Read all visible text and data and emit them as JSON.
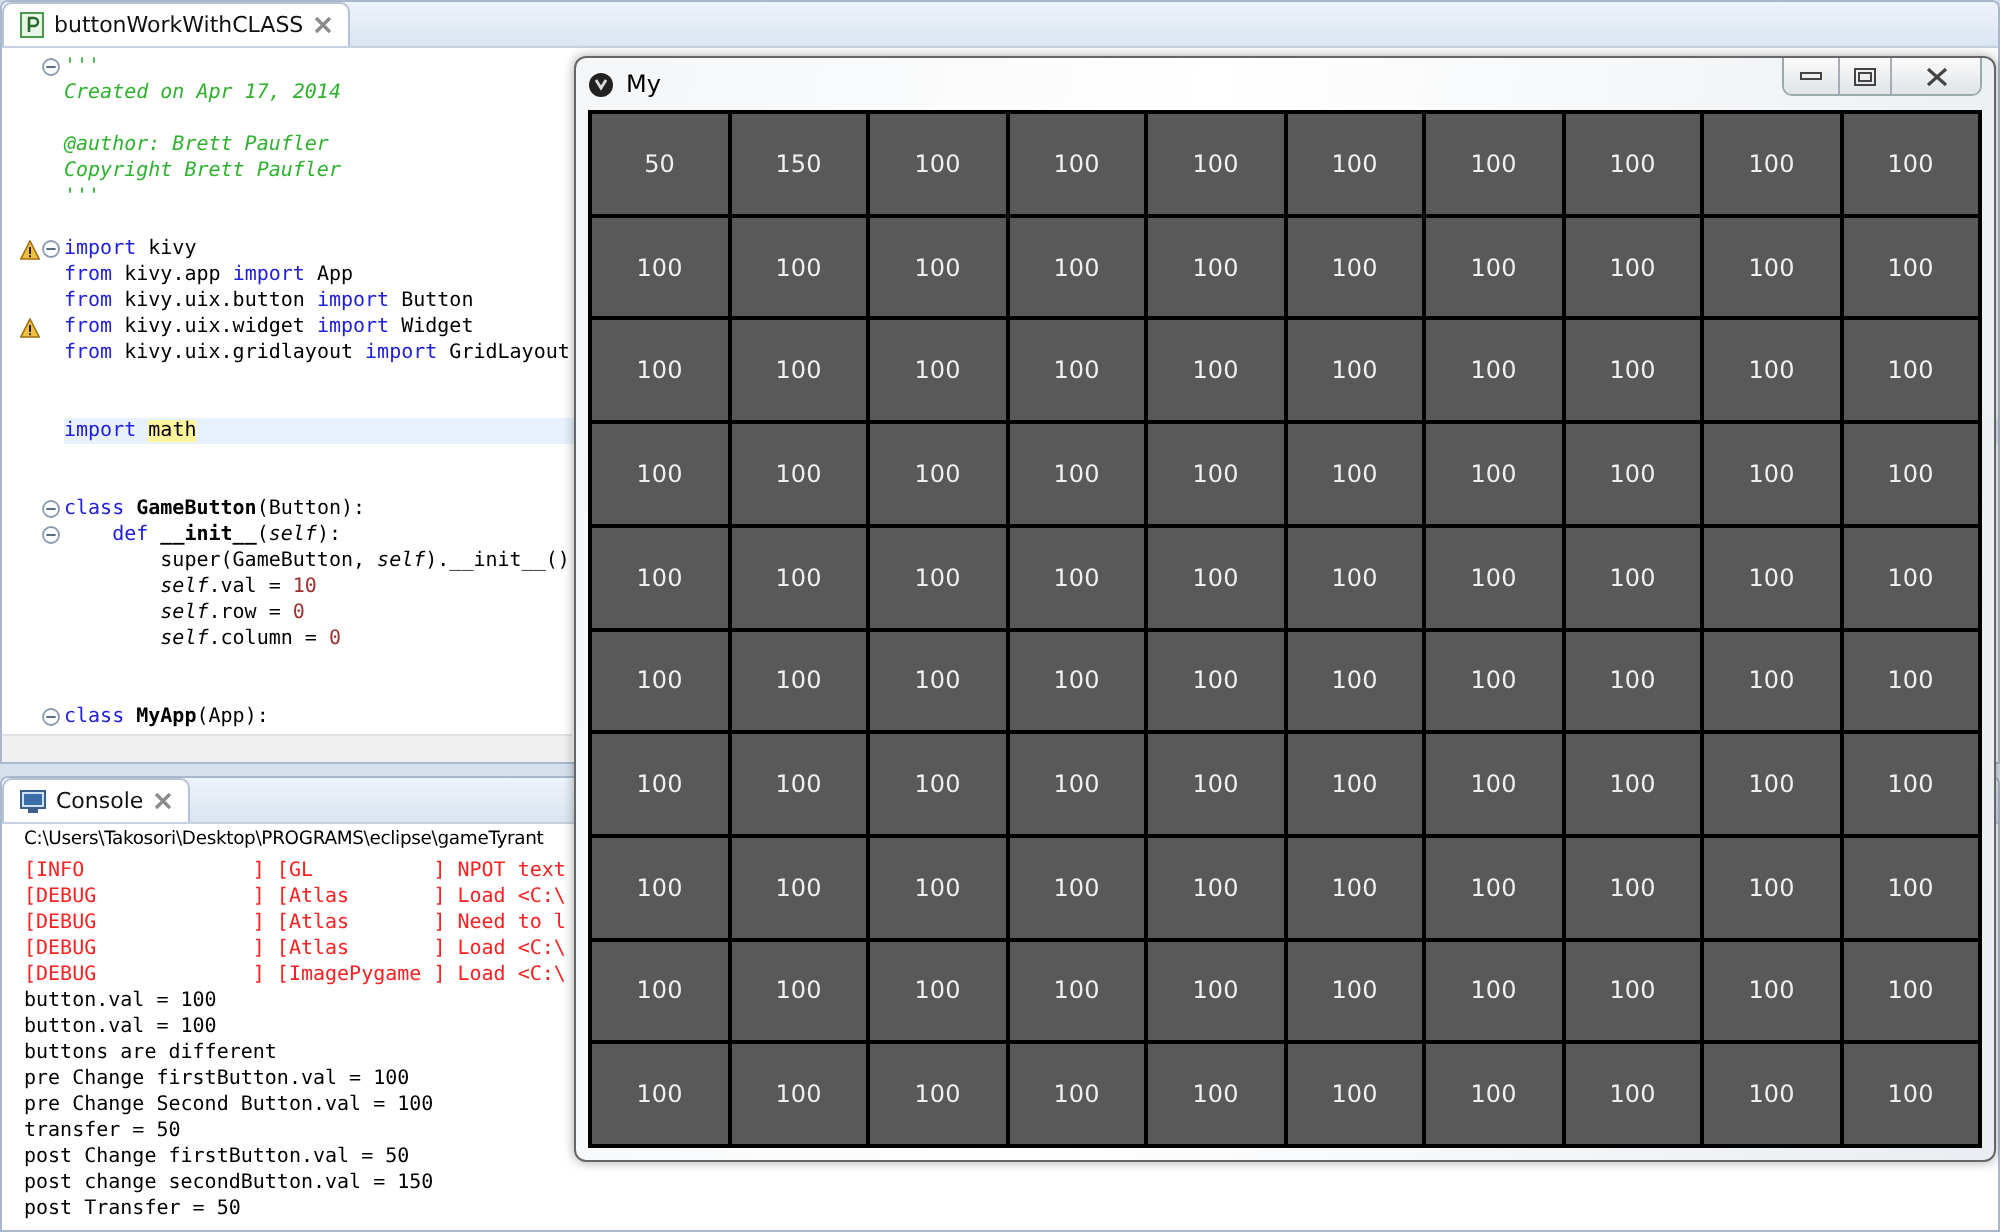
{
  "editor": {
    "tab": {
      "title": "buttonWorkWithCLASS",
      "selected": true
    },
    "lines": [
      {
        "fold": true,
        "warning": false,
        "current": false,
        "parts": [
          {
            "kind": "comment",
            "text": "'''"
          }
        ]
      },
      {
        "fold": false,
        "warning": false,
        "current": false,
        "parts": [
          {
            "kind": "comment",
            "text": "Created on Apr 17, 2014"
          }
        ]
      },
      {
        "fold": false,
        "warning": false,
        "current": false
      },
      {
        "fold": false,
        "warning": false,
        "current": false,
        "parts": [
          {
            "kind": "comment",
            "text": "@author: Brett Paufler"
          }
        ]
      },
      {
        "fold": false,
        "warning": false,
        "current": false,
        "parts": [
          {
            "kind": "comment",
            "text": "Copyright Brett Paufler"
          }
        ]
      },
      {
        "fold": false,
        "warning": false,
        "current": false,
        "parts": [
          {
            "kind": "comment",
            "text": "'''"
          }
        ]
      },
      {
        "fold": false,
        "warning": false,
        "current": false
      },
      {
        "fold": true,
        "warning": true,
        "current": false,
        "parts": [
          {
            "kind": "keyword",
            "text": "import"
          },
          {
            "kind": "plain",
            "text": " kivy"
          }
        ]
      },
      {
        "fold": false,
        "warning": false,
        "current": false,
        "parts": [
          {
            "kind": "keyword",
            "text": "from"
          },
          {
            "kind": "plain",
            "text": " kivy.app "
          },
          {
            "kind": "keyword",
            "text": "import"
          },
          {
            "kind": "plain",
            "text": " App"
          }
        ]
      },
      {
        "fold": false,
        "warning": false,
        "current": false,
        "parts": [
          {
            "kind": "keyword",
            "text": "from"
          },
          {
            "kind": "plain",
            "text": " kivy.uix.button "
          },
          {
            "kind": "keyword",
            "text": "import"
          },
          {
            "kind": "plain",
            "text": " Button"
          }
        ]
      },
      {
        "fold": false,
        "warning": true,
        "current": false,
        "parts": [
          {
            "kind": "keyword",
            "text": "from"
          },
          {
            "kind": "plain",
            "text": " kivy.uix.widget "
          },
          {
            "kind": "keyword",
            "text": "import"
          },
          {
            "kind": "plain",
            "text": " Widget"
          }
        ]
      },
      {
        "fold": false,
        "warning": false,
        "current": false,
        "parts": [
          {
            "kind": "keyword",
            "text": "from"
          },
          {
            "kind": "plain",
            "text": " kivy.uix.gridlayout "
          },
          {
            "kind": "keyword",
            "text": "import"
          },
          {
            "kind": "plain",
            "text": " GridLayout"
          }
        ]
      },
      {
        "fold": false,
        "warning": false,
        "current": false
      },
      {
        "fold": false,
        "warning": false,
        "current": false
      },
      {
        "fold": false,
        "warning": false,
        "current": true,
        "parts": [
          {
            "kind": "keyword",
            "text": "import "
          },
          {
            "kind": "occurrence",
            "text": "math"
          }
        ]
      },
      {
        "fold": false,
        "warning": false,
        "current": false
      },
      {
        "fold": false,
        "warning": false,
        "current": false
      },
      {
        "fold": true,
        "warning": false,
        "current": false,
        "parts": [
          {
            "kind": "keyword",
            "text": "class "
          },
          {
            "kind": "name",
            "text": "GameButton"
          },
          {
            "kind": "plain",
            "text": "(Button):"
          }
        ]
      },
      {
        "fold": true,
        "warning": false,
        "current": false,
        "parts": [
          {
            "kind": "keyword",
            "text": "    def "
          },
          {
            "kind": "name",
            "text": "__init__"
          },
          {
            "kind": "plain",
            "text": "("
          },
          {
            "kind": "self",
            "text": "self"
          },
          {
            "kind": "plain",
            "text": "):"
          }
        ]
      },
      {
        "fold": false,
        "warning": false,
        "current": false,
        "parts": [
          {
            "kind": "plain",
            "text": "        super(GameButton, "
          },
          {
            "kind": "self",
            "text": "self"
          },
          {
            "kind": "plain",
            "text": ").__init__()"
          }
        ]
      },
      {
        "fold": false,
        "warning": false,
        "current": false,
        "parts": [
          {
            "kind": "self",
            "text": "        self"
          },
          {
            "kind": "plain",
            "text": ".val = "
          },
          {
            "kind": "number",
            "text": "10"
          }
        ]
      },
      {
        "fold": false,
        "warning": false,
        "current": false,
        "parts": [
          {
            "kind": "self",
            "text": "        self"
          },
          {
            "kind": "plain",
            "text": ".row = "
          },
          {
            "kind": "number",
            "text": "0"
          }
        ]
      },
      {
        "fold": false,
        "warning": false,
        "current": false,
        "parts": [
          {
            "kind": "self",
            "text": "        self"
          },
          {
            "kind": "plain",
            "text": ".column = "
          },
          {
            "kind": "number",
            "text": "0"
          }
        ]
      },
      {
        "fold": false,
        "warning": false,
        "current": false
      },
      {
        "fold": false,
        "warning": false,
        "current": false
      },
      {
        "fold": true,
        "warning": false,
        "current": false,
        "parts": [
          {
            "kind": "keyword",
            "text": "class "
          },
          {
            "kind": "name",
            "text": "MyApp"
          },
          {
            "kind": "plain",
            "text": "(App):"
          }
        ]
      }
    ]
  },
  "console": {
    "tab": {
      "title": "Console",
      "selected": true
    },
    "path": "C:\\Users\\Takosori\\Desktop\\PROGRAMS\\eclipse\\gameTyrant",
    "lines": [
      {
        "kind": "error",
        "text": "[INFO              ] [GL          ] NPOT text"
      },
      {
        "kind": "error",
        "text": "[DEBUG             ] [Atlas       ] Load <C:\\"
      },
      {
        "kind": "error",
        "text": "[DEBUG             ] [Atlas       ] Need to l"
      },
      {
        "kind": "error",
        "text": "[DEBUG             ] [Atlas       ] Load <C:\\"
      },
      {
        "kind": "error",
        "text": "[DEBUG             ] [ImagePygame ] Load <C:\\"
      },
      {
        "kind": "output",
        "text": "button.val = 100"
      },
      {
        "kind": "output",
        "text": "button.val = 100"
      },
      {
        "kind": "output",
        "text": "buttons are different"
      },
      {
        "kind": "output",
        "text": "pre Change firstButton.val = 100"
      },
      {
        "kind": "output",
        "text": "pre Change Second Button.val = 100"
      },
      {
        "kind": "output",
        "text": "transfer = 50"
      },
      {
        "kind": "output",
        "text": "post Change firstButton.val = 50"
      },
      {
        "kind": "output",
        "text": "post change secondButton.val = 150"
      },
      {
        "kind": "output",
        "text": "post Transfer = 50"
      }
    ]
  },
  "app_window": {
    "title": "My",
    "grid": [
      [
        "50",
        "150",
        "100",
        "100",
        "100",
        "100",
        "100",
        "100",
        "100",
        "100"
      ],
      [
        "100",
        "100",
        "100",
        "100",
        "100",
        "100",
        "100",
        "100",
        "100",
        "100"
      ],
      [
        "100",
        "100",
        "100",
        "100",
        "100",
        "100",
        "100",
        "100",
        "100",
        "100"
      ],
      [
        "100",
        "100",
        "100",
        "100",
        "100",
        "100",
        "100",
        "100",
        "100",
        "100"
      ],
      [
        "100",
        "100",
        "100",
        "100",
        "100",
        "100",
        "100",
        "100",
        "100",
        "100"
      ],
      [
        "100",
        "100",
        "100",
        "100",
        "100",
        "100",
        "100",
        "100",
        "100",
        "100"
      ],
      [
        "100",
        "100",
        "100",
        "100",
        "100",
        "100",
        "100",
        "100",
        "100",
        "100"
      ],
      [
        "100",
        "100",
        "100",
        "100",
        "100",
        "100",
        "100",
        "100",
        "100",
        "100"
      ],
      [
        "100",
        "100",
        "100",
        "100",
        "100",
        "100",
        "100",
        "100",
        "100",
        "100"
      ],
      [
        "100",
        "100",
        "100",
        "100",
        "100",
        "100",
        "100",
        "100",
        "100",
        "100"
      ]
    ]
  }
}
